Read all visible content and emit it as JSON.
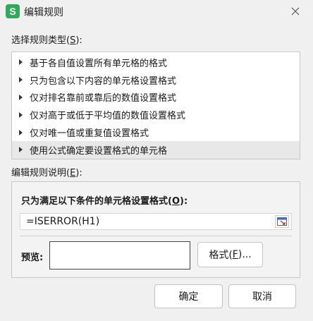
{
  "window": {
    "title": "编辑规则",
    "app_icon_letter": "S"
  },
  "rule_type": {
    "label": "选择规则类型(",
    "label_key": "S",
    "label_suffix": "):",
    "items": [
      "基于各自值设置所有单元格的格式",
      "只为包含以下内容的单元格设置格式",
      "仅对排名靠前或靠后的数值设置格式",
      "仅对高于或低于平均值的数值设置格式",
      "仅对唯一值或重复值设置格式",
      "使用公式确定要设置格式的单元格"
    ],
    "selected_index": 5
  },
  "description": {
    "label": "编辑规则说明(",
    "label_key": "E",
    "label_suffix": "):",
    "heading": "只为满足以下条件的单元格设置格式(",
    "heading_key": "O",
    "heading_suffix": "):",
    "formula_value": "=ISERROR(H1)",
    "preview_label": "预览:",
    "format_button_prefix": "格式(",
    "format_button_key": "F",
    "format_button_suffix": ")..."
  },
  "buttons": {
    "ok": "确定",
    "cancel": "取消"
  },
  "colors": {
    "accent": "#2fa95a",
    "selected_row": "#e8e8e8"
  }
}
